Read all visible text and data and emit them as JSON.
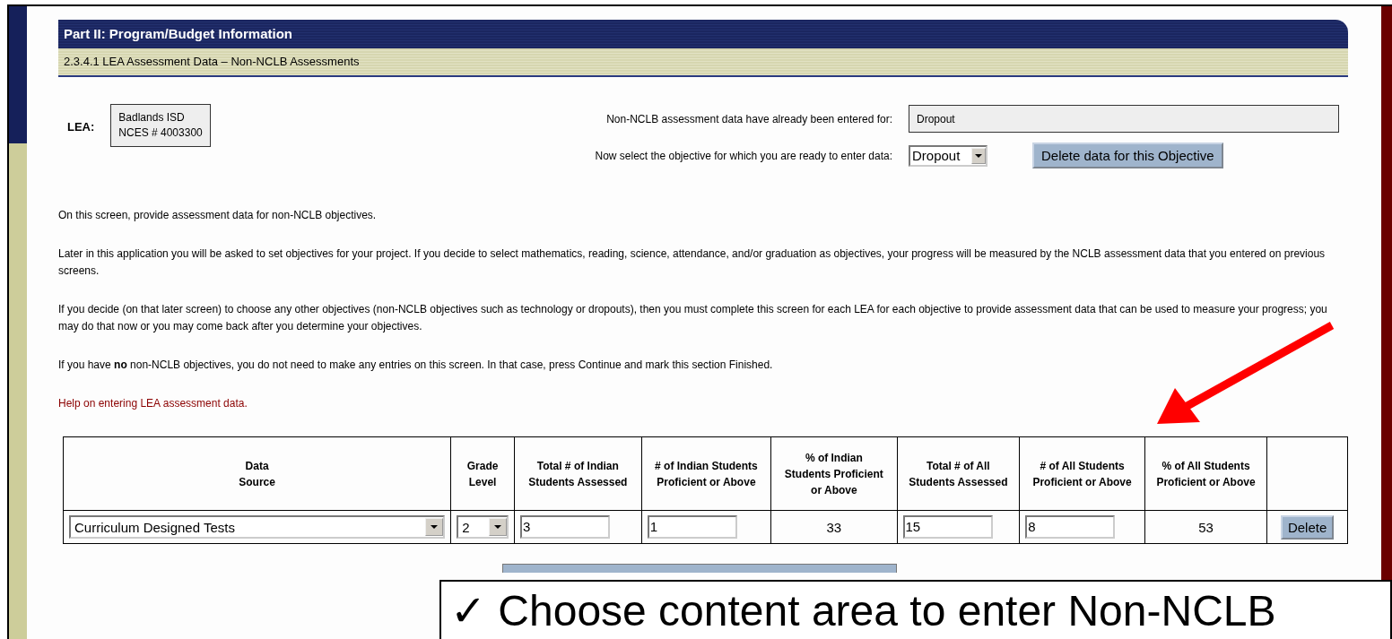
{
  "header": {
    "title": "Part II: Program/Budget Information",
    "subtitle": "2.3.4.1 LEA Assessment Data – Non-NCLB Assessments"
  },
  "lea": {
    "label": "LEA:",
    "lines": [
      "Badlands ISD",
      "NCES # 4003300"
    ]
  },
  "entered": {
    "label": "Non-NCLB assessment data have already been entered for:",
    "value": "Dropout"
  },
  "objective": {
    "label": "Now select the objective for which you are ready to enter data:",
    "value": "Dropout"
  },
  "delete_objective_button": "Delete data for this Objective",
  "paragraphs": [
    "On this screen, provide assessment data for non-NCLB objectives.",
    "Later in this application you will be asked to set objectives for your project. If you decide to select mathematics, reading, science, attendance, and/or graduation as objectives, your progress will be measured by the NCLB assessment data that you entered on previous screens.",
    "If you decide (on that later screen) to choose any other objectives (non-NCLB objectives such as technology or dropouts), then you must complete this screen for each LEA for each objective to provide assessment data that can be used to measure your progress; you may do that now or you may come back after you determine your objectives.",
    "If you have **no** non-NCLB objectives, you do not need to make any entries on this screen. In that case, press Continue and mark this section Finished."
  ],
  "help_link": "Help on entering LEA assessment data.",
  "table": {
    "columns": [
      "Data\nSource",
      "Grade Level",
      "Total # of Indian Students Assessed",
      "# of Indian Students Proficient or Above",
      "% of Indian Students Proficient or Above",
      "Total # of All Students Assessed",
      "# of All Students Proficient or Above",
      "% of All Students Proficient or Above"
    ],
    "rows": [
      {
        "cells": [
          {
            "kind": "select",
            "value": "Curriculum Designed Tests"
          },
          {
            "kind": "select",
            "value": "2"
          },
          {
            "kind": "input",
            "value": "3"
          },
          {
            "kind": "input",
            "value": "1"
          },
          {
            "kind": "text",
            "value": "33"
          },
          {
            "kind": "input",
            "value": "15"
          },
          {
            "kind": "input",
            "value": "8"
          },
          {
            "kind": "text",
            "value": "53"
          },
          {
            "kind": "button",
            "value": "Delete"
          }
        ]
      }
    ]
  },
  "callout": {
    "check": "✓",
    "text": "Choose content area to enter Non-NCLB"
  }
}
